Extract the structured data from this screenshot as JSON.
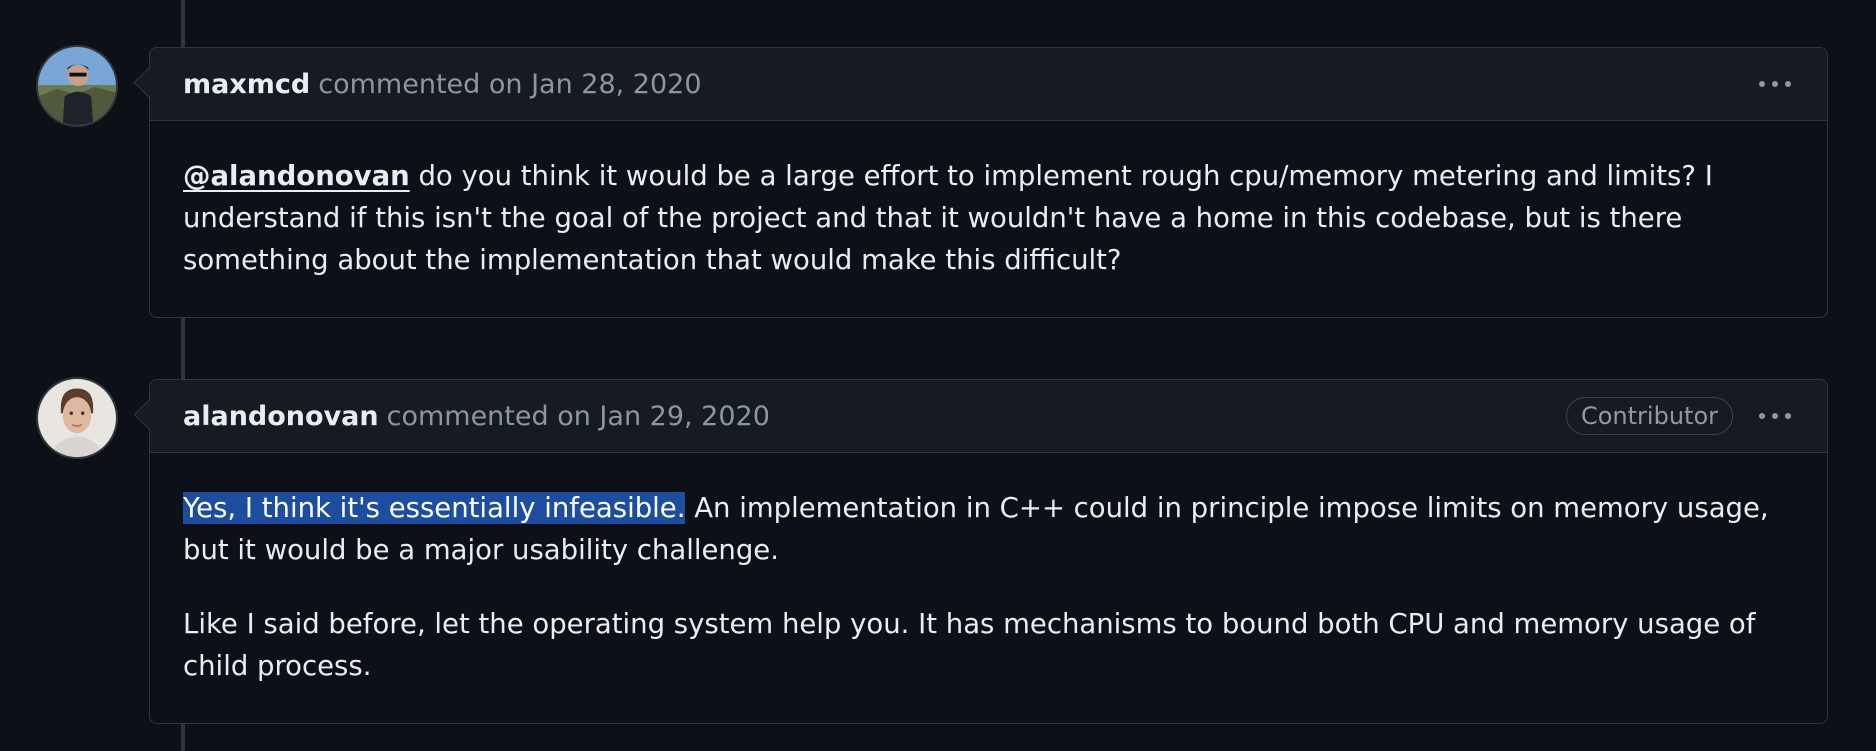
{
  "comments": [
    {
      "author": "maxmcd",
      "meta": "commented on Jan 28, 2020",
      "mention": "@alandonovan",
      "body": " do you think it would be a large effort to implement rough cpu/memory metering and limits? I understand if this isn't the goal of the project and that it wouldn't have a home in this codebase, but is there something about the implementation that would make this difficult?"
    },
    {
      "author": "alandonovan",
      "meta": "commented on Jan 29, 2020",
      "badge": "Contributor",
      "highlighted": "Yes, I think it's essentially infeasible.",
      "body1": " An implementation in C++ could in principle impose limits on memory usage, but it would be a major usability challenge.",
      "body2": "Like I said before, let the operating system help you. It has mechanisms to bound both CPU and memory usage of child process."
    }
  ],
  "colors": {
    "background": "#0d1117",
    "header_bg": "#161b22",
    "border": "#30363d",
    "muted_text": "#8d96a0",
    "selection": "#1c4d9e"
  },
  "icons": [
    "avatar-maxmcd",
    "avatar-alandonovan",
    "kebab-more-icon"
  ]
}
